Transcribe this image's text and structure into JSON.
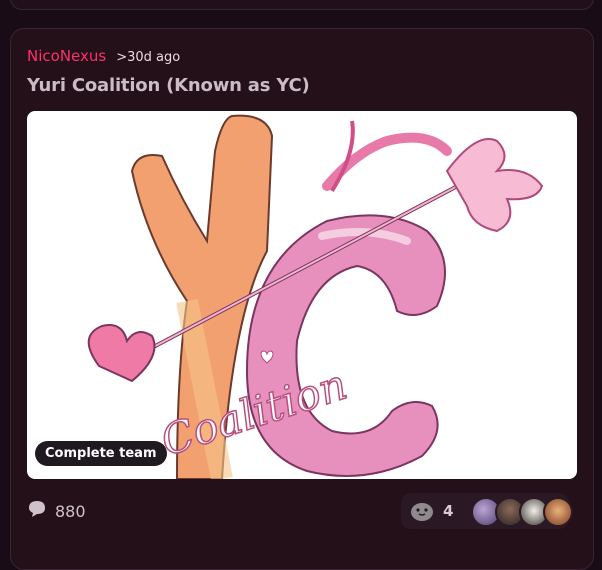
{
  "post": {
    "author": "NicoNexus",
    "time": ">30d ago",
    "title": "Yuri Coalition (Known as YC)",
    "badge": "Complete team",
    "comment_count": "880",
    "member_count": "4"
  },
  "icons": {
    "comment": "speech-bubble-icon",
    "team": "seal-icon"
  },
  "colors": {
    "author": "#ff2f6c",
    "card_bg": "#231019",
    "page_bg": "#1a0c16"
  }
}
